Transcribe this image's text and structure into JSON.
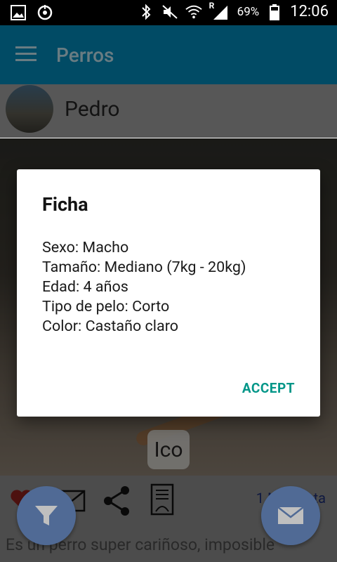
{
  "status_bar": {
    "battery_percent": "69%",
    "time": "12:06",
    "network_roaming": "R",
    "icons": [
      "gallery-icon",
      "sync-icon",
      "bluetooth-icon",
      "mute-icon",
      "wifi-icon",
      "signal-icon",
      "battery-icon"
    ]
  },
  "toolbar": {
    "title": "Perros",
    "color": "#0288b8"
  },
  "profile": {
    "name": "Pedro"
  },
  "photo_overlay": {
    "label": "Ico"
  },
  "actions": {
    "likes_text": "1 Me gusta",
    "heart_color": "#e53935"
  },
  "description": {
    "text": "Es un perro super cariñoso, imposible"
  },
  "dialog": {
    "title": "Ficha",
    "lines": [
      "Sexo: Macho",
      "Tamaño: Mediano (7kg - 20kg)",
      "Edad: 4 años",
      "Tipo de pelo: Corto",
      "Color: Castaño claro"
    ],
    "accept_label": "ACCEPT",
    "accent": "#009688"
  },
  "fabs": {
    "left_icon": "filter-icon",
    "right_icon": "mail-icon",
    "color": "#6a8ec7"
  }
}
